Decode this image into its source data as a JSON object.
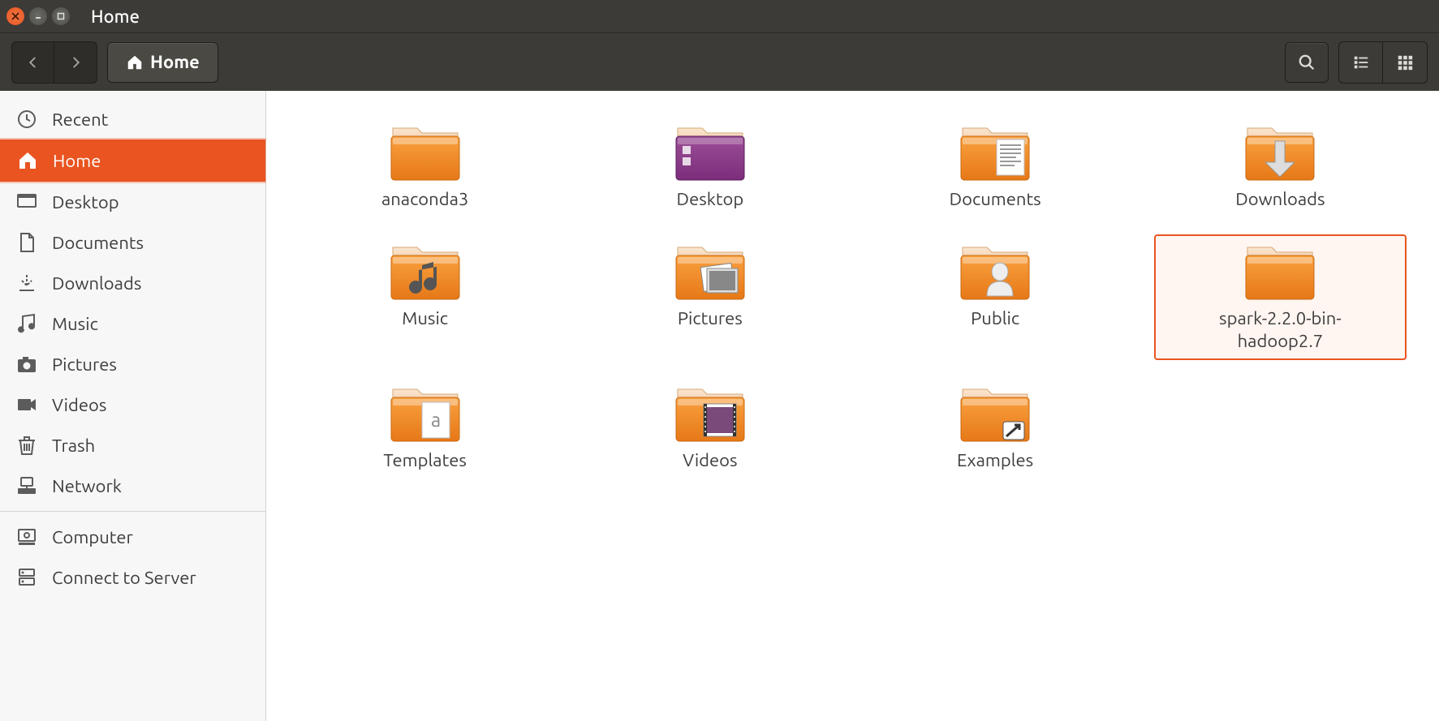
{
  "window": {
    "title": "Home"
  },
  "breadcrumb": {
    "label": "Home"
  },
  "sidebar": {
    "items": [
      {
        "label": "Recent",
        "icon": "clock"
      },
      {
        "label": "Home",
        "icon": "home",
        "selected": true
      },
      {
        "label": "Desktop",
        "icon": "desktop"
      },
      {
        "label": "Documents",
        "icon": "document"
      },
      {
        "label": "Downloads",
        "icon": "download-arrow"
      },
      {
        "label": "Music",
        "icon": "music"
      },
      {
        "label": "Pictures",
        "icon": "camera"
      },
      {
        "label": "Videos",
        "icon": "video"
      },
      {
        "label": "Trash",
        "icon": "trash"
      },
      {
        "label": "Network",
        "icon": "network"
      }
    ],
    "items2": [
      {
        "label": "Computer",
        "icon": "computer"
      },
      {
        "label": "Connect to Server",
        "icon": "server"
      }
    ]
  },
  "folders": [
    {
      "label": "anaconda3",
      "type": "plain"
    },
    {
      "label": "Desktop",
      "type": "desktop"
    },
    {
      "label": "Documents",
      "type": "documents"
    },
    {
      "label": "Downloads",
      "type": "downloads"
    },
    {
      "label": "Music",
      "type": "music"
    },
    {
      "label": "Pictures",
      "type": "pictures"
    },
    {
      "label": "Public",
      "type": "public"
    },
    {
      "label": "spark-2.2.0-bin-hadoop2.7",
      "type": "plain",
      "highlighted": true
    },
    {
      "label": "Templates",
      "type": "templates"
    },
    {
      "label": "Videos",
      "type": "videos"
    },
    {
      "label": "Examples",
      "type": "examples"
    }
  ]
}
